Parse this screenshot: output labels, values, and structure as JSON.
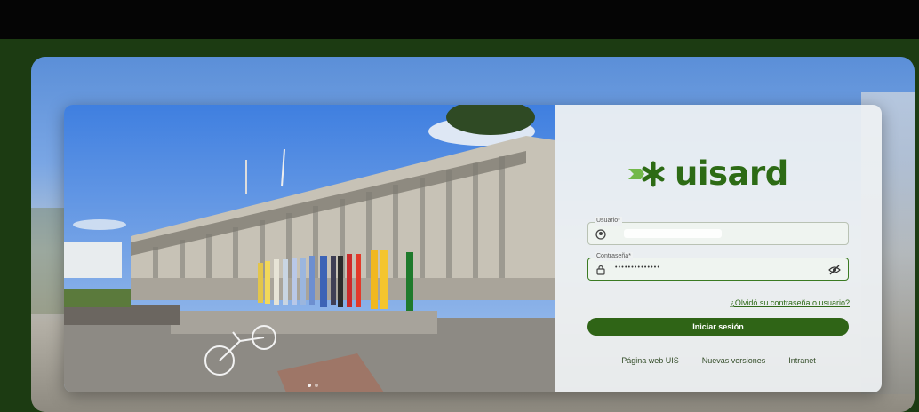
{
  "brand": {
    "name": "uisard",
    "color": "#2d6b15"
  },
  "form": {
    "username": {
      "label": "Usuario*",
      "value": ""
    },
    "password": {
      "label": "Contraseña*",
      "value": "••••••••••••••"
    },
    "forgot_link": "¿Olvidó su contraseña o usuario?",
    "submit_label": "Iniciar sesión"
  },
  "footer_links": [
    "Página web UIS",
    "Nuevas versiones",
    "Intranet"
  ],
  "icons": {
    "logo": "asterisk-arrow-logo-icon",
    "username": "user-circle-icon",
    "password": "lock-icon",
    "toggle": "eye-slash-icon"
  },
  "colors": {
    "accent": "#2f6416",
    "frame": "#1c3b12",
    "top_bar": "#050505"
  }
}
